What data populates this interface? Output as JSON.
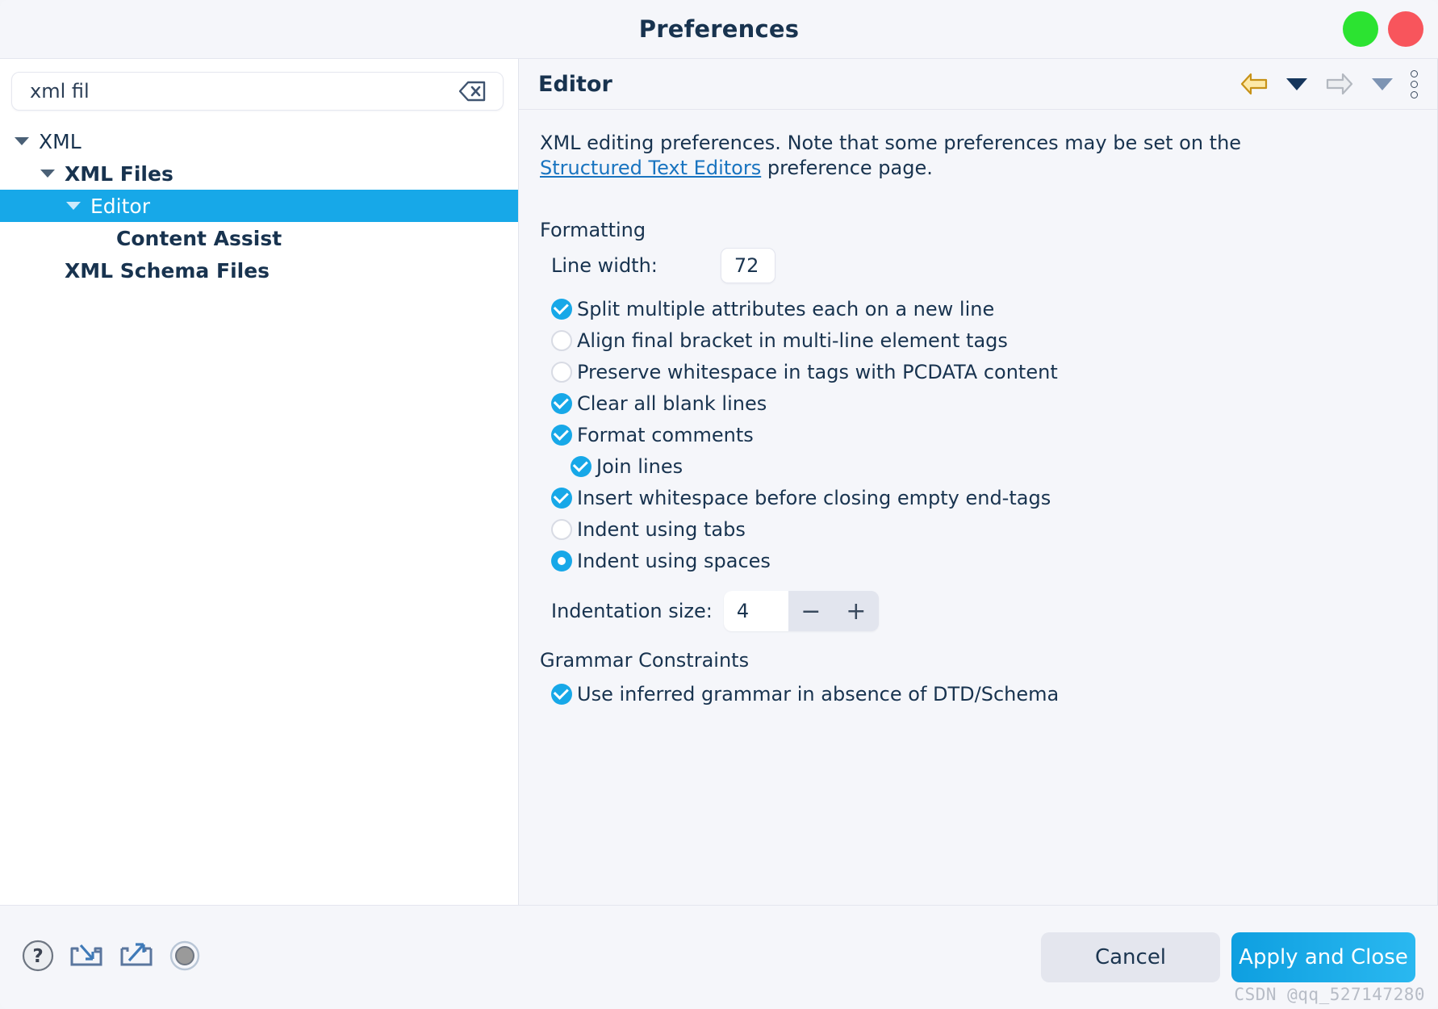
{
  "window": {
    "title": "Preferences",
    "controls": [
      {
        "name": "maximize",
        "color": "#2ce331"
      },
      {
        "name": "close",
        "color": "#f8555c"
      }
    ]
  },
  "search": {
    "value": "xml fil",
    "placeholder": "type filter text",
    "clear_icon": "clear-backspace-icon"
  },
  "tree": {
    "items": [
      {
        "label": "XML",
        "level": 0,
        "expanded": true,
        "selected": false,
        "bold": false
      },
      {
        "label": "XML Files",
        "level": 1,
        "expanded": true,
        "selected": false,
        "bold": true
      },
      {
        "label": "Editor",
        "level": 2,
        "expanded": true,
        "selected": true,
        "bold": false
      },
      {
        "label": "Content Assist",
        "level": 3,
        "expanded": false,
        "selected": false,
        "bold": true
      },
      {
        "label": "XML Schema Files",
        "level": 1,
        "expanded": false,
        "selected": false,
        "bold": true
      }
    ]
  },
  "pane": {
    "title": "Editor",
    "tools": [
      {
        "name": "back-arrow-icon"
      },
      {
        "name": "back-dropdown-icon"
      },
      {
        "name": "forward-arrow-icon"
      },
      {
        "name": "forward-dropdown-icon"
      },
      {
        "name": "view-menu-icon"
      }
    ],
    "description": {
      "before": "XML editing preferences.  Note that some preferences may be set on the ",
      "link": "Structured Text Editors",
      "after": " preference page."
    },
    "formatting": {
      "group_label": "Formatting",
      "line_width_label": "Line width:",
      "line_width_value": "72",
      "options": [
        {
          "label": "Split multiple attributes each on a new line",
          "type": "checkbox",
          "checked": true,
          "indent": 0
        },
        {
          "label": "Align final bracket in multi-line element tags",
          "type": "checkbox",
          "checked": false,
          "indent": 0
        },
        {
          "label": "Preserve whitespace in tags with PCDATA content",
          "type": "checkbox",
          "checked": false,
          "indent": 0
        },
        {
          "label": "Clear all blank lines",
          "type": "checkbox",
          "checked": true,
          "indent": 0
        },
        {
          "label": "Format comments",
          "type": "checkbox",
          "checked": true,
          "indent": 0
        },
        {
          "label": "Join lines",
          "type": "checkbox",
          "checked": true,
          "indent": 1
        },
        {
          "label": "Insert whitespace before closing empty end-tags",
          "type": "checkbox",
          "checked": true,
          "indent": 0
        },
        {
          "label": "Indent using tabs",
          "type": "radio",
          "checked": false,
          "indent": 0
        },
        {
          "label": "Indent using spaces",
          "type": "radio",
          "checked": true,
          "indent": 0
        }
      ],
      "indentation_label": "Indentation size:",
      "indentation_value": "4",
      "stepper_minus": "−",
      "stepper_plus": "+"
    },
    "grammar": {
      "group_label": "Grammar Constraints",
      "options": [
        {
          "label": "Use inferred grammar in absence of DTD/Schema",
          "type": "checkbox",
          "checked": true,
          "indent": 0
        }
      ]
    }
  },
  "footer": {
    "icons": [
      {
        "name": "help-icon"
      },
      {
        "name": "import-icon"
      },
      {
        "name": "export-icon"
      },
      {
        "name": "restore-defaults-icon"
      }
    ],
    "cancel_label": "Cancel",
    "apply_label": "Apply and Close",
    "watermark": "CSDN @qq_527147280"
  },
  "colors": {
    "accent": "#17a8e8",
    "title_text": "#18334f",
    "link": "#1974c0",
    "selection": "#17a8e8"
  }
}
